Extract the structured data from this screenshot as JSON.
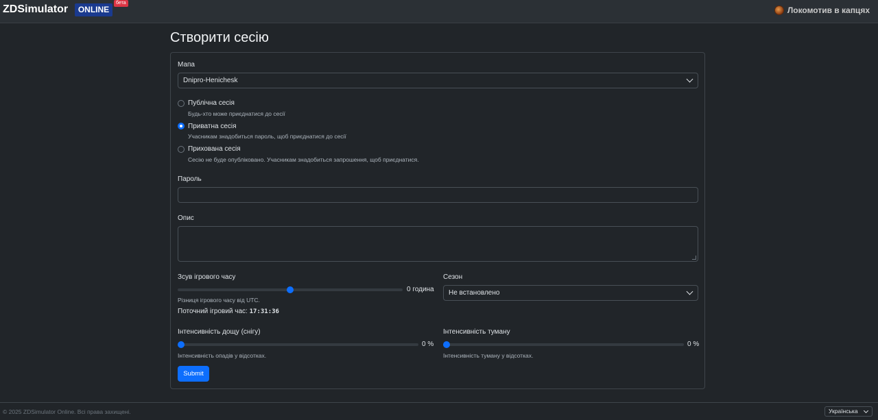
{
  "header": {
    "brand": "ZDSimulator",
    "brand_badge": "ONLINE",
    "beta_badge": "бета",
    "user_name": "Локомотив в капцях"
  },
  "page": {
    "title": "Створити сесію"
  },
  "form": {
    "map": {
      "label": "Мапа",
      "value": "Dnipro-Henichesk"
    },
    "visibility": [
      {
        "label": "Публічна сесія",
        "help": "Будь-хто може приєднатися до сесії",
        "checked": false
      },
      {
        "label": "Приватна сесія",
        "help": "Учасникам знадобиться пароль, щоб приєднатися до сесії",
        "checked": true
      },
      {
        "label": "Прихована сесія",
        "help": "Сесію не буде опубліковано. Учасникам знадобиться запрошення, щоб приєднатися.",
        "checked": false
      }
    ],
    "password": {
      "label": "Пароль",
      "value": ""
    },
    "description": {
      "label": "Опис",
      "value": ""
    },
    "time_offset": {
      "label": "Зсув ігрового часу",
      "value_text": "0 година",
      "fraction": 0.5,
      "help": "Різниця ігрового часу від UTC.",
      "current_label": "Поточний ігровий час:",
      "current_time": "17:31:36"
    },
    "season": {
      "label": "Сезон",
      "value": "Не встановлено"
    },
    "rain": {
      "label": "Інтенсивність дощу (снігу)",
      "value_text": "0 %",
      "fraction": 0,
      "help": "Інтенсивність опадів у відсотках."
    },
    "fog": {
      "label": "Інтенсивність туману",
      "value_text": "0 %",
      "fraction": 0,
      "help": "Інтенсивність туману у відсотках."
    },
    "submit_label": "Submit"
  },
  "footer": {
    "copyright": "© 2025 ZDSimulator Online. Всі права захищені.",
    "language": "Українська"
  },
  "colors": {
    "accent": "#0d6efd",
    "background": "#212529",
    "beta": "#dc3545",
    "brand_badge": "#1a3a8f"
  },
  "icons": {
    "avatar": "locomotive-avatar-icon",
    "dropdown": "chevron-down-icon"
  }
}
